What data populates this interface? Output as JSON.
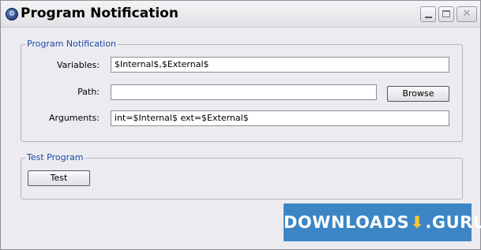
{
  "window": {
    "title": "Program Notification",
    "close_symbol": "✕"
  },
  "group_notification": {
    "label": "Program Notification",
    "variables_label": "Variables:",
    "variables_value": "$Internal$,$External$",
    "path_label": "Path:",
    "path_value": "",
    "browse_label": "Browse",
    "arguments_label": "Arguments:",
    "arguments_value": "int=$Internal$ ext=$External$"
  },
  "group_test": {
    "label": "Test Program",
    "test_label": "Test"
  },
  "watermark": {
    "text_left": "DOWNLOADS",
    "icon": "⬇",
    "text_right": ".GURU"
  }
}
